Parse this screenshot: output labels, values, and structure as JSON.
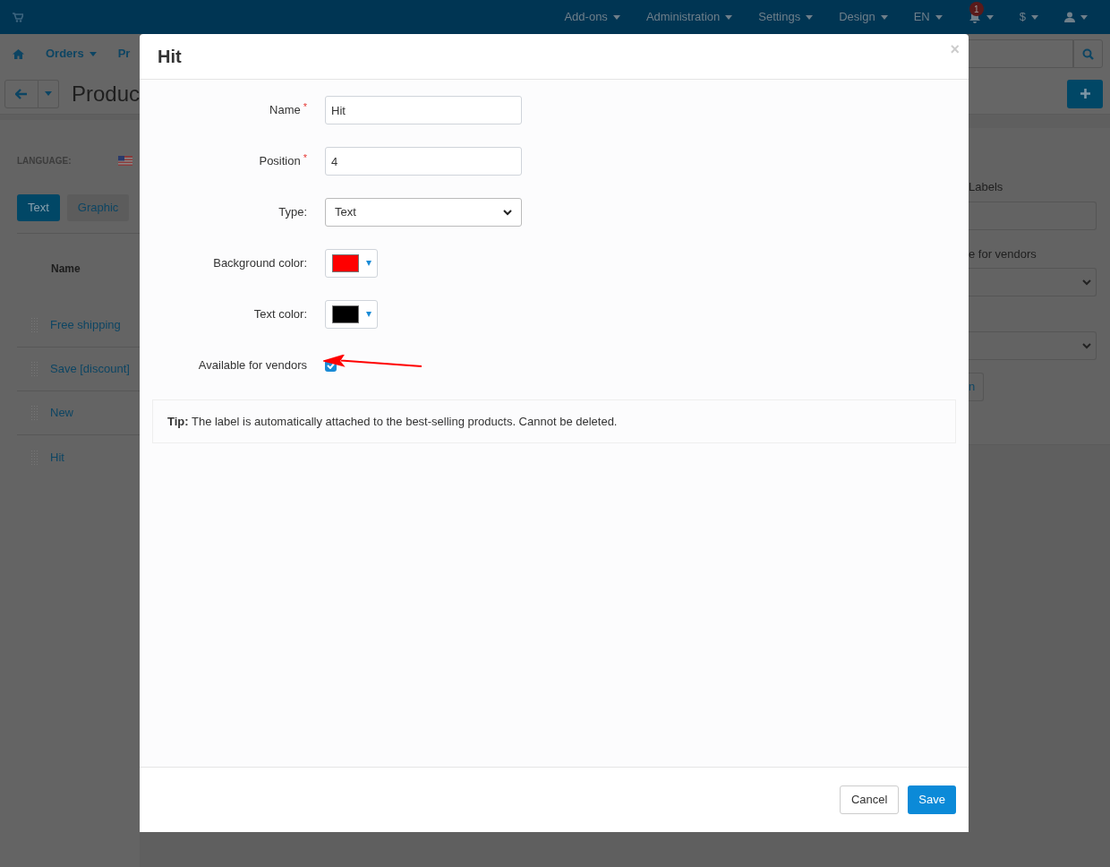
{
  "top_nav": {
    "items": [
      {
        "label": "Add-ons"
      },
      {
        "label": "Administration"
      },
      {
        "label": "Settings"
      },
      {
        "label": "Design"
      },
      {
        "label": "EN"
      }
    ],
    "notification_count": "1",
    "currency": "$"
  },
  "second_nav": {
    "items": [
      {
        "label": "Orders"
      },
      {
        "label": "Pr"
      }
    ]
  },
  "page_title": "Produc",
  "language_label": "LANGUAGE:",
  "tabs": [
    {
      "label": "Text",
      "selected": true
    },
    {
      "label": "Graphic",
      "selected": false
    }
  ],
  "table": {
    "column": "Name",
    "rows": [
      "Free shipping",
      "Save [discount]",
      "New",
      "Hit"
    ]
  },
  "right_panel": {
    "label_1": "Labels",
    "label_2": "e for vendors",
    "button_text": "n"
  },
  "modal": {
    "title": "Hit",
    "close": "×",
    "fields": [
      {
        "kind": "text",
        "label": "Name",
        "required_mark": "*",
        "value": "Hit"
      },
      {
        "kind": "text",
        "label": "Position",
        "required_mark": "*",
        "value": "4"
      },
      {
        "kind": "select",
        "label": "Type:",
        "value": "Text"
      },
      {
        "kind": "color",
        "label": "Background color:",
        "color": "#ff0000"
      },
      {
        "kind": "color",
        "label": "Text color:",
        "color": "#000000"
      },
      {
        "kind": "checkbox",
        "label": "Available for vendors",
        "checked": true
      }
    ],
    "tip": "**Tip:** The label is automatically attached to the best-selling products. Cannot be deleted.",
    "buttons": {
      "cancel": "Cancel",
      "save": "Save"
    }
  }
}
